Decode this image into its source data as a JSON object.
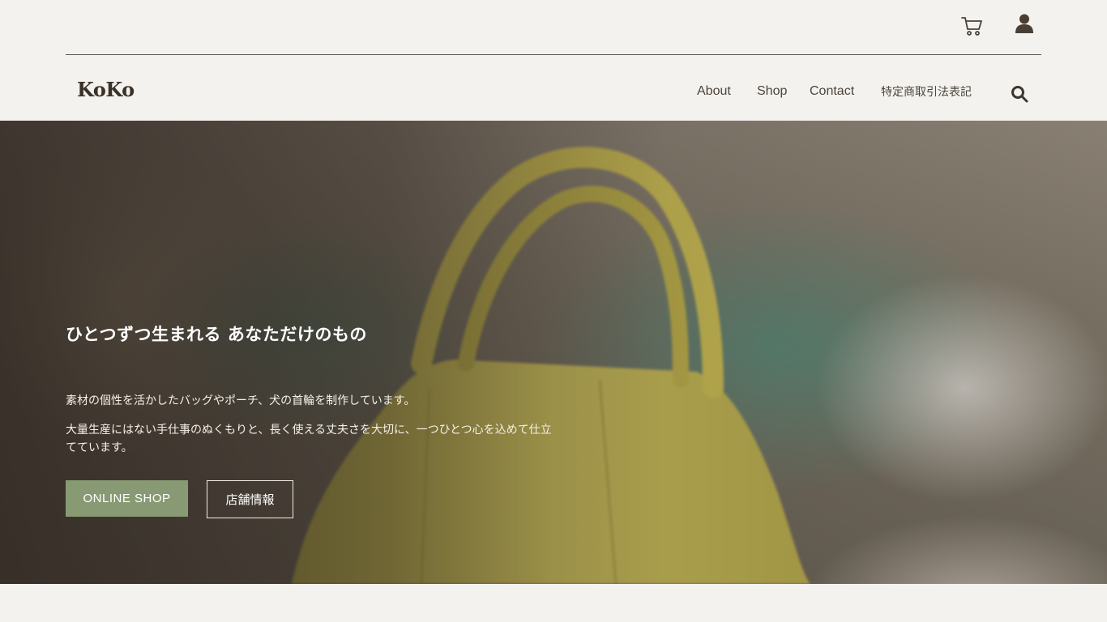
{
  "header": {
    "cart_icon": "cart-icon",
    "account_icon": "user-icon"
  },
  "nav": {
    "logo": "KoKo",
    "items": [
      {
        "label": "About"
      },
      {
        "label": "Shop"
      },
      {
        "label": "Contact"
      },
      {
        "label": "特定商取引法表記"
      }
    ],
    "search_icon": "search-icon"
  },
  "hero": {
    "title": "ひとつずつ生まれる あなただけのもの",
    "text1": "素材の個性を活かしたバッグやポーチ、犬の首輪を制作しています。",
    "text2": "大量生産にはない手仕事のぬくもりと、長く使える丈夫さを大切に、一つひとつ心を込めて仕立てています。",
    "button_shop": "ONLINE SHOP",
    "button_store": "店舗情報"
  },
  "colors": {
    "background": "#f3f2ee",
    "accent_green": "#889a73",
    "text_dark": "#3d362f",
    "bag_yellow": "#d9cd5e"
  }
}
